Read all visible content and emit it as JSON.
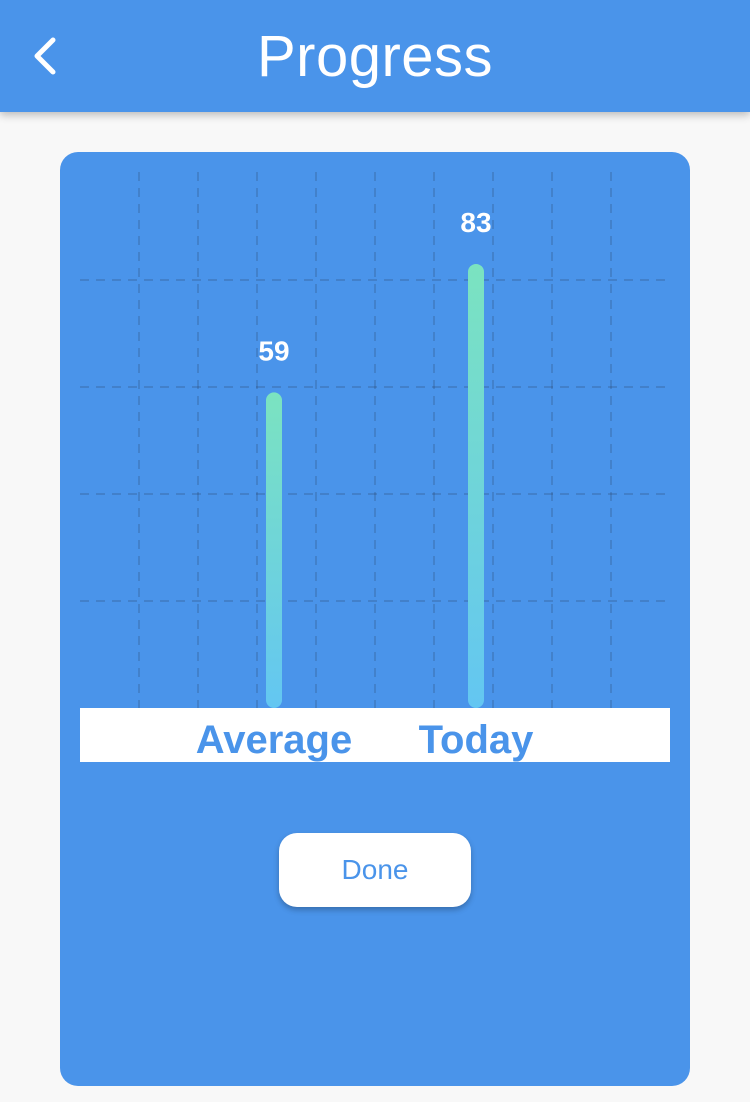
{
  "header": {
    "title": "Progress",
    "back_icon": "chevron-left-icon",
    "background": "#4a94ea"
  },
  "colors": {
    "accent": "#4a94ea",
    "background": "#f8f8f8",
    "bar_top": "#7be3c0",
    "bar_bottom": "#63c6f2"
  },
  "chart_data": {
    "type": "bar",
    "title": "",
    "xlabel": "",
    "ylabel": "",
    "categories": [
      "Average",
      "Today"
    ],
    "values": [
      59,
      83
    ],
    "ylim": [
      0,
      100
    ],
    "grid": true,
    "value_labels": [
      "59",
      "83"
    ]
  },
  "actions": {
    "done_label": "Done"
  }
}
